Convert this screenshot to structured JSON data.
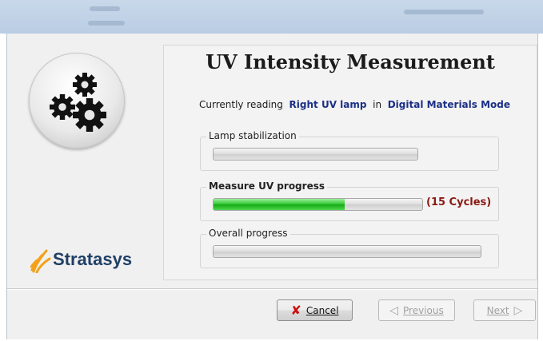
{
  "title": "UV Intensity Measurement",
  "reading": {
    "prefix": "Currently reading",
    "lamp": "Right UV lamp",
    "in": "in",
    "mode": "Digital Materials Mode"
  },
  "groups": {
    "lamp_stabilization": {
      "label": "Lamp stabilization",
      "progress": 0
    },
    "measure_uv": {
      "label": "Measure UV progress",
      "progress": 0.63,
      "cycles": "(15 Cycles)"
    },
    "overall": {
      "label": "Overall progress",
      "progress": 0
    }
  },
  "brand": {
    "name": "Stratasys"
  },
  "buttons": {
    "cancel": {
      "label": "Cancel",
      "icon": "x-icon",
      "enabled": true
    },
    "previous": {
      "label": "Previous",
      "icon": "arrow-left-icon",
      "enabled": false
    },
    "next": {
      "label": "Next",
      "icon": "arrow-right-icon",
      "enabled": false
    }
  },
  "colors": {
    "accent_text": "#1c2f86",
    "cycles_text": "#8a1a14",
    "progress_green": "#2ec42e",
    "brand_blue": "#1f3f66",
    "brand_orange": "#f2a21a"
  }
}
